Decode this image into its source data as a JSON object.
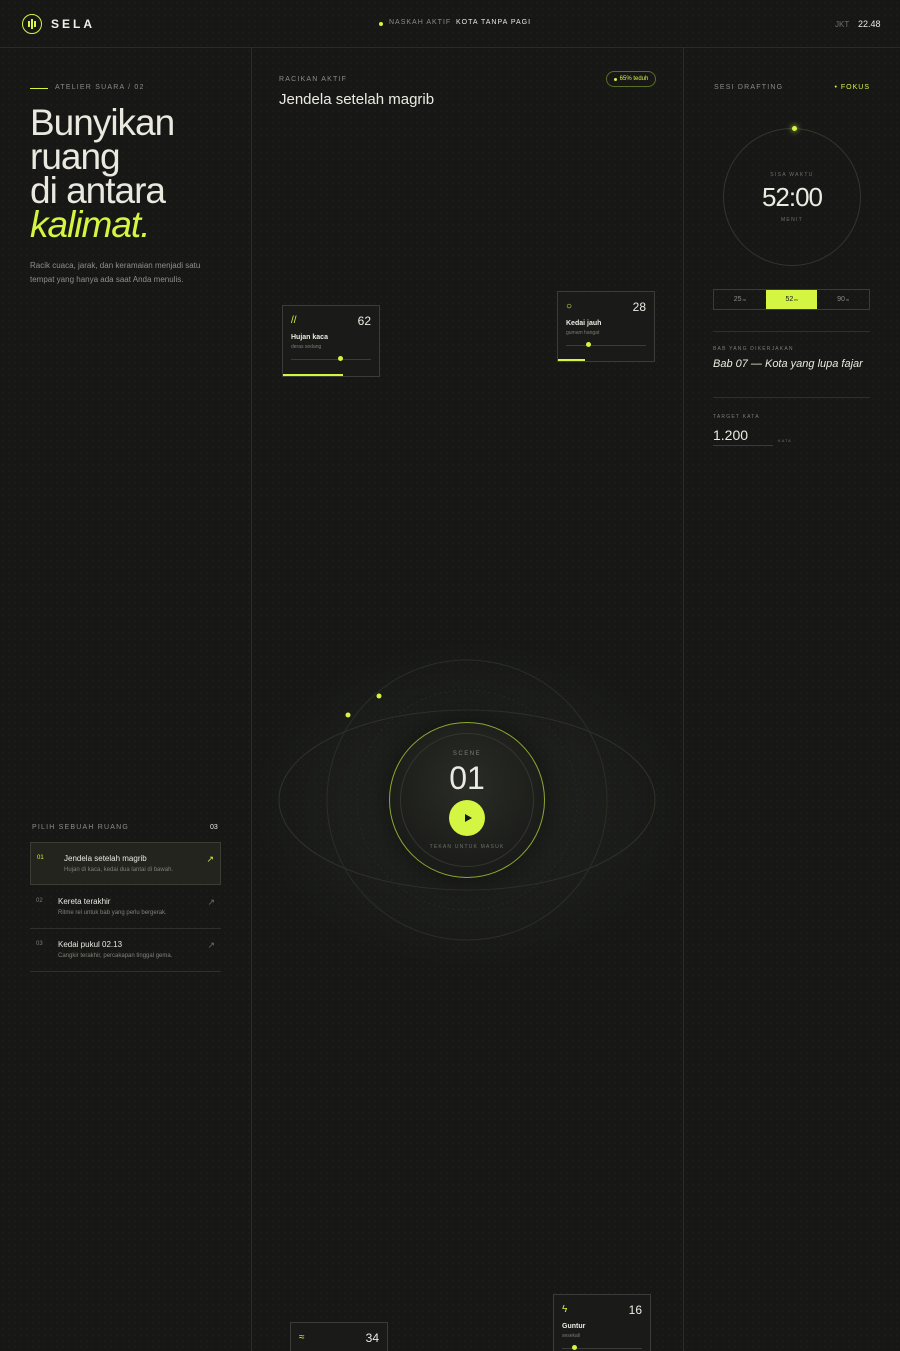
{
  "header": {
    "brand": "SELA",
    "active_label": "NASKAH AKTIF",
    "active_script": "KOTA TANPA PAGI",
    "city": "JKT",
    "time": "22.48"
  },
  "left": {
    "eyebrow": "ATELIER SUARA / 02",
    "headline": [
      "Bunyikan",
      "ruang",
      "di antara"
    ],
    "headline_em": "kalimat.",
    "intro": "Racik cuaca, jarak, dan keramaian menjadi satu tempat yang hanya ada saat Anda menulis.",
    "rooms_title": "PILIH SEBUAH RUANG",
    "rooms_count": "03",
    "rooms": [
      {
        "num": "01",
        "name": "Jendela setelah magrib",
        "desc": "Hujan di kaca, kedai dua lantai di bawah.",
        "arrow": "↗"
      },
      {
        "num": "02",
        "name": "Kereta terakhir",
        "desc": "Ritme rel untuk bab yang perlu bergerak.",
        "arrow": "↗"
      },
      {
        "num": "03",
        "name": "Kedai pukul 02.13",
        "desc": "Cangkir terakhir, percakapan tinggal gema.",
        "arrow": "↗"
      }
    ]
  },
  "center": {
    "mix_label": "RACIKAN AKTIF",
    "mix_title": "Jendela setelah magrib",
    "badge": "65% teduh",
    "cards": [
      {
        "icon": "//",
        "value": "62",
        "name": "Hujan kaca",
        "sub": "deras sedang",
        "level": 0.62
      },
      {
        "icon": "○",
        "value": "28",
        "name": "Kedai jauh",
        "sub": "gumam hangat",
        "level": 0.28
      },
      {
        "icon": "ϟ",
        "value": "16",
        "name": "Guntur",
        "sub": "sesekali",
        "level": 0.16
      },
      {
        "icon": "≈",
        "value": "34",
        "name": "",
        "sub": "",
        "level": 0.34
      }
    ],
    "scene_label": "SCENE",
    "scene_num": "01",
    "scene_hint": "TEKAN UNTUK MASUK"
  },
  "right": {
    "sesi_label": "SESI DRAFTING",
    "sesi_mode": "• FOKUS",
    "timer_caption": "SISA WAKTU",
    "timer_value": "52:00",
    "timer_unit": "MENIT",
    "durations": [
      {
        "value": "25",
        "unit": "m"
      },
      {
        "value": "52",
        "unit": "m"
      },
      {
        "value": "90",
        "unit": "m"
      }
    ],
    "bab_label": "BAB YANG DIKERJAKAN",
    "bab_value": "Bab 07 — Kota yang lupa fajar",
    "target_label": "TARGET KATA",
    "target_value": "1.200",
    "target_unit": "KATA"
  },
  "colors": {
    "accent": "#d4f542",
    "background": "#171816"
  }
}
